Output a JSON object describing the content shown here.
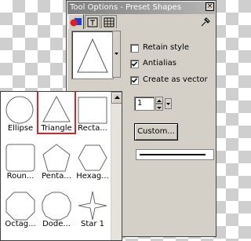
{
  "window": {
    "title": "Tool Options - Preset Shapes",
    "close_glyph": "×"
  },
  "tabs": [
    {
      "icon": "shape-tool-icon"
    },
    {
      "icon": "text-tool-icon"
    },
    {
      "icon": "grid-tool-icon"
    }
  ],
  "options": {
    "retain_style": {
      "label": "Retain style",
      "checked": false
    },
    "antialias": {
      "label": "Antialias",
      "checked": true
    },
    "create_as_vector": {
      "label": "Create as vector",
      "checked": true
    },
    "line_width_value": "1",
    "custom_button_label": "Custom..."
  },
  "shapes": [
    {
      "label": "Ellipse",
      "icon": "ellipse-icon"
    },
    {
      "label": "Triangle",
      "icon": "triangle-icon",
      "selected": true
    },
    {
      "label": "Recta...",
      "icon": "rectangle-icon"
    },
    {
      "label": "Roun...",
      "icon": "rounded-rectangle-icon"
    },
    {
      "label": "Penta...",
      "icon": "pentagon-icon"
    },
    {
      "label": "Hexag...",
      "icon": "hexagon-icon"
    },
    {
      "label": "Octag...",
      "icon": "octagon-icon"
    },
    {
      "label": "Dode...",
      "icon": "dodecagon-icon"
    },
    {
      "label": "Star 1",
      "icon": "star-icon"
    }
  ],
  "colors": {
    "selection": "#d0262c",
    "title_bar": "#7f7f7f",
    "panel_bg": "#d4d0c8"
  }
}
